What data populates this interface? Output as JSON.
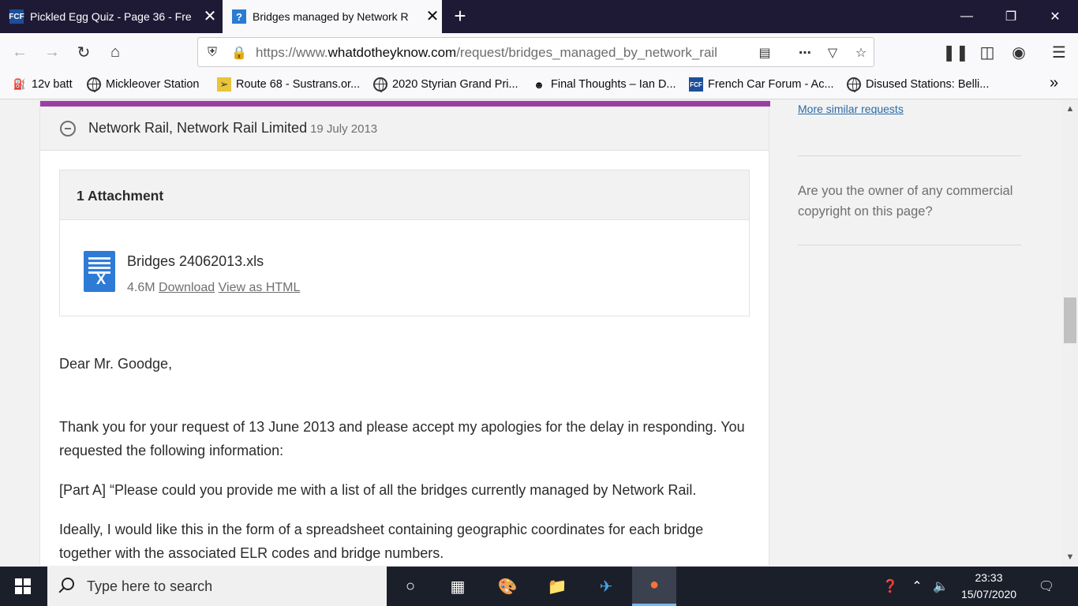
{
  "browser": {
    "tabs": [
      {
        "title": "Pickled Egg Quiz - Page 36 - Fre",
        "favicon": "fcf-favicon"
      },
      {
        "title": "Bridges managed by Network R",
        "favicon": "question-favicon"
      }
    ],
    "url": {
      "prefix": "https://www.",
      "domain": "whatdotheyknow.com",
      "path": "/request/bridges_managed_by_network_rail"
    },
    "bookmarks": [
      {
        "label": "12v batt",
        "icon": "fuel-icon"
      },
      {
        "label": "Mickleover Station",
        "icon": "globe-icon"
      },
      {
        "label": "Route 68 - Sustrans.or...",
        "icon": "sustrans-icon"
      },
      {
        "label": "2020 Styrian Grand Pri...",
        "icon": "globe-icon"
      },
      {
        "label": "Final Thoughts – Ian D...",
        "icon": "avatar-icon"
      },
      {
        "label": "French Car Forum - Ac...",
        "icon": "fcf-icon"
      },
      {
        "label": "Disused Stations: Belli...",
        "icon": "globe-icon"
      }
    ]
  },
  "correspondence": {
    "authority": "Network Rail, Network Rail Limited",
    "date": "19 July 2013",
    "attachments_title": "1 Attachment",
    "file": {
      "name": "Bridges 24062013.xls",
      "size": "4.6M",
      "download": "Download",
      "view_html": "View as HTML"
    },
    "body": {
      "greeting": "Dear Mr. Goodge,",
      "p1": "Thank you for your request of 13 June 2013 and please accept my apologies for the delay in responding. You requested the following information:",
      "p2": "[Part A] “Please could you provide me with a list of all the bridges currently managed by Network Rail.",
      "p3": "Ideally, I would like this in the form of a spreadsheet containing geographic coordinates for each bridge together with the associated ELR codes and bridge numbers."
    }
  },
  "sidebar": {
    "similar_link": "More similar requests",
    "owner_question": "Are you the owner of any commercial copyright on this page?"
  },
  "taskbar": {
    "search_placeholder": "Type here to search",
    "time": "23:33",
    "date": "15/07/2020"
  },
  "colors": {
    "accent": "#9b3ea3",
    "link": "#2b6aa6",
    "tabstrip": "#1e1a36"
  }
}
